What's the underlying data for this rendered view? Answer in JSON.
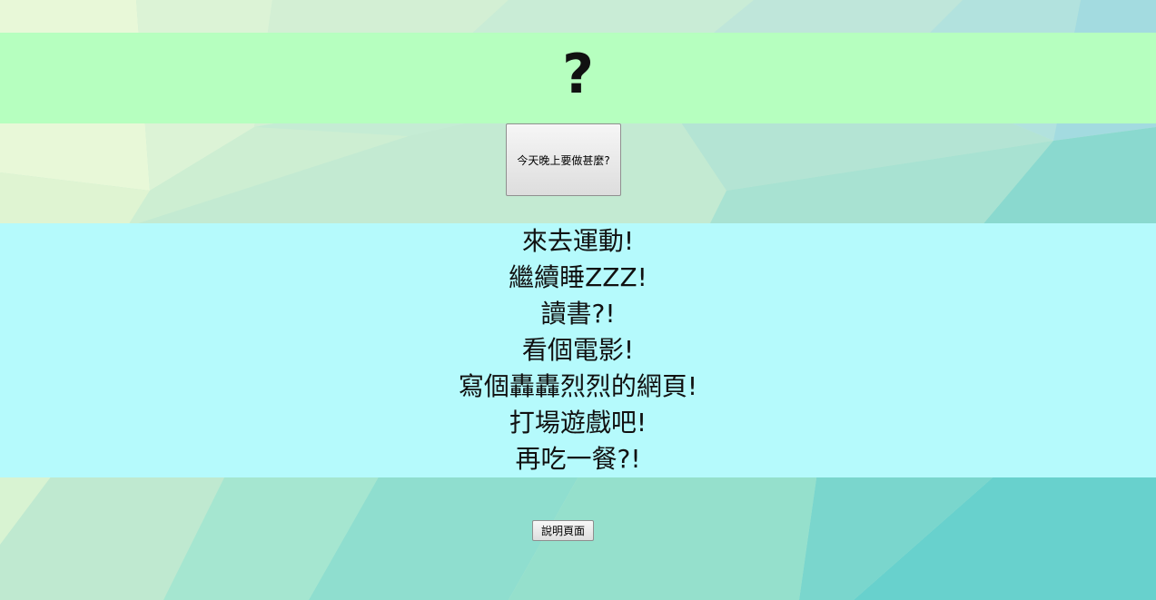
{
  "header": {
    "symbol": "?"
  },
  "main": {
    "decide_button_label": "今天晚上要做甚麼?",
    "options": [
      "來去運動!",
      "繼續睡ZZZ!",
      "讀書?!",
      "看個電影!",
      "寫個轟轟烈烈的網頁!",
      "打場遊戲吧!",
      "再吃一餐?!"
    ]
  },
  "footer": {
    "help_button_label": "說明頁面"
  },
  "colors": {
    "top_band": "#b6ffbf",
    "list_band": "#b5fafc",
    "background_light": "#e6f7d6",
    "background_teal": "#6fd4cf"
  }
}
